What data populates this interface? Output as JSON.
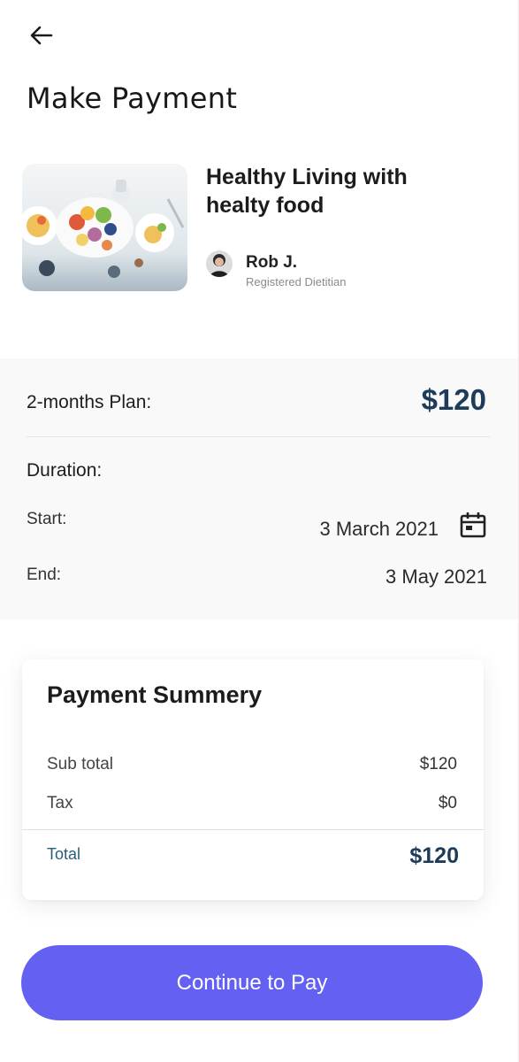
{
  "header": {
    "back_icon": "arrow-left-icon",
    "title": "Make Payment"
  },
  "course": {
    "image": "healthy-food-platter-image",
    "title": "Healthy Living with healty food",
    "author": {
      "name": "Rob J.",
      "role": "Registered Dietitian"
    }
  },
  "plan": {
    "label": "2-months Plan:",
    "price": "$120",
    "duration_label": "Duration:",
    "start_label": "Start:",
    "start_date": "3 March 2021",
    "end_label": "End:",
    "end_date": "3 May 2021",
    "calendar_icon": "calendar-icon"
  },
  "summary": {
    "title": "Payment Summery",
    "subtotal_label": "Sub total",
    "subtotal_value": "$120",
    "tax_label": "Tax",
    "tax_value": "$0",
    "total_label": "Total",
    "total_value": "$120"
  },
  "actions": {
    "continue_label": "Continue to Pay"
  },
  "colors": {
    "accent": "#6360f2",
    "price": "#1d3c5a",
    "total_label": "#2a5d7c"
  }
}
